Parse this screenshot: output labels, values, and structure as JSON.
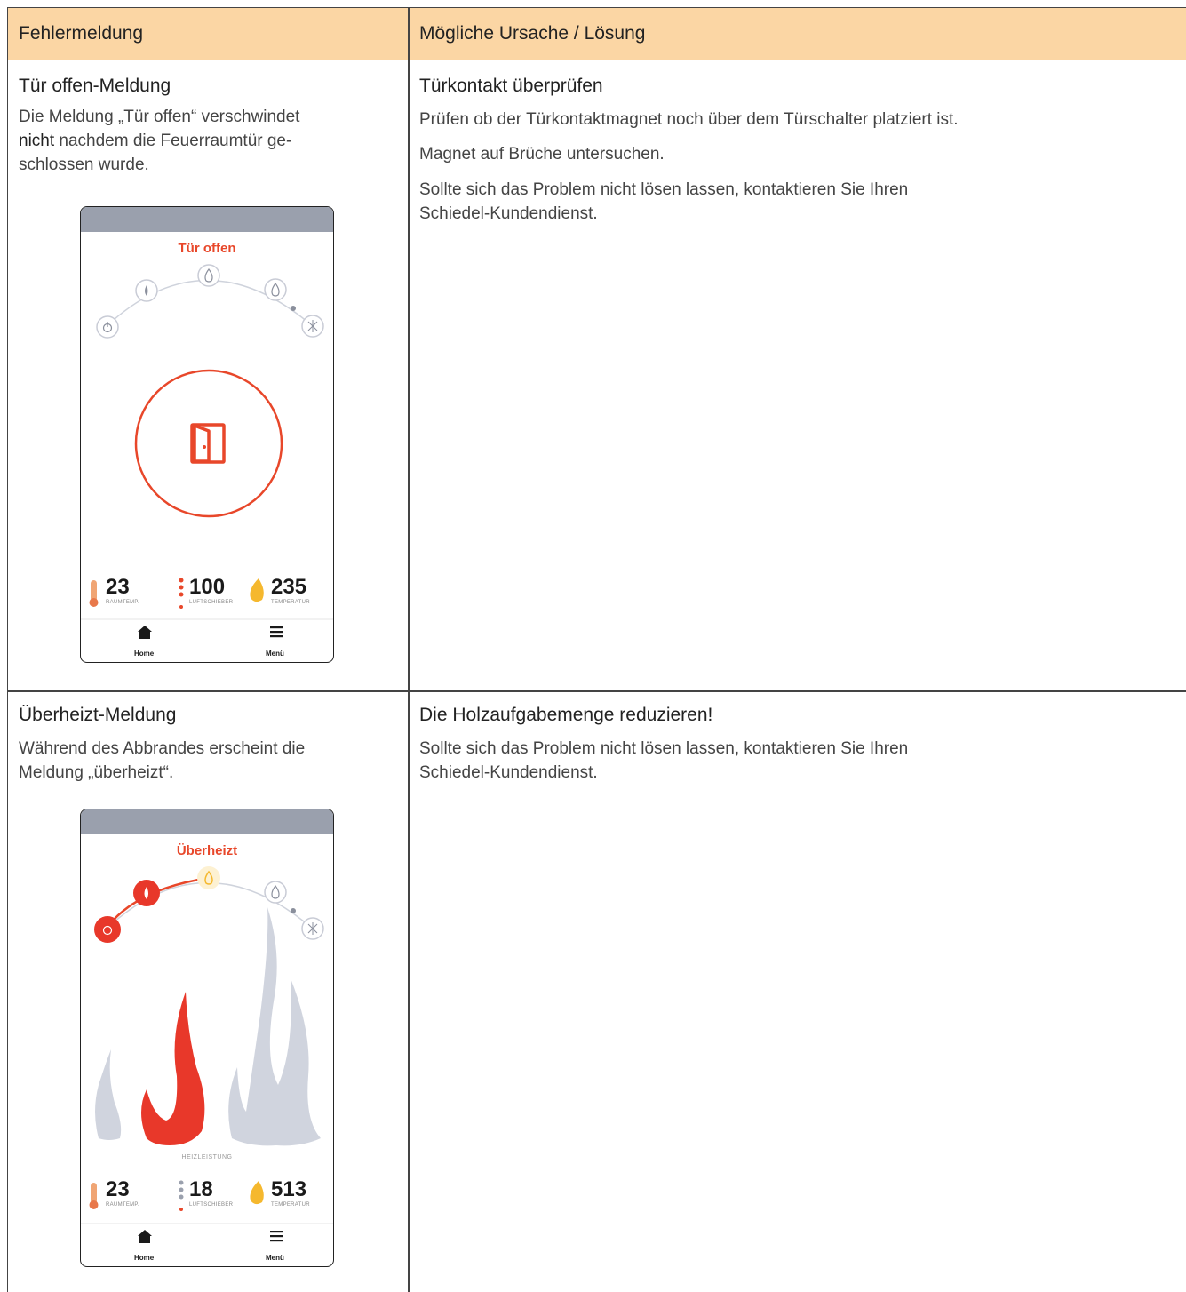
{
  "header": {
    "col1": "Fehlermeldung",
    "col2": "Mögliche Ursache / Lösung"
  },
  "rows": [
    {
      "title": "Tür offen-Meldung",
      "desc_pre": "Die Meldung „Tür offen“ verschwindet",
      "desc_bold": "nicht",
      "desc_post1": " nachdem die Feuerraumtür ge-",
      "desc_post2": "schlossen wurde.",
      "solution_title": "Türkontakt überprüfen",
      "solution_lines": [
        "Prüfen ob der Türkontaktmagnet noch über dem Türschalter platziert ist.",
        "Magnet auf Brüche untersuchen.",
        "Sollte sich das Problem nicht lösen lassen, kontaktieren Sie Ihren",
        "Schiedel-Kundendienst."
      ],
      "phone": {
        "status": "Tür offen",
        "stats": [
          {
            "value": "23",
            "label": "RAUMTEMP."
          },
          {
            "value": "100",
            "label": "LUFTSCHIEBER"
          },
          {
            "value": "235",
            "label": "TEMPERATUR"
          }
        ],
        "nav": [
          "Home",
          "Menü"
        ]
      }
    },
    {
      "title": "Überheizt-Meldung",
      "desc_line1": "Während des Abbrandes erscheint die",
      "desc_line2": "Meldung „überheizt“.",
      "solution_title": "Die Holzaufgabemenge reduzieren!",
      "solution_lines": [
        "Sollte sich das Problem nicht lösen lassen, kontaktieren Sie Ihren",
        "Schiedel-Kundendienst."
      ],
      "phone": {
        "status": "Überheizt",
        "power_label": "HEIZLEISTUNG",
        "stats": [
          {
            "value": "23",
            "label": "RAUMTEMP."
          },
          {
            "value": "18",
            "label": "LUFTSCHIEBER"
          },
          {
            "value": "513",
            "label": "TEMPERATUR"
          }
        ],
        "nav": [
          "Home",
          "Menü"
        ]
      }
    }
  ],
  "colors": {
    "header_bg": "#fbd6a4",
    "alert_red": "#e8472a",
    "flame_yellow": "#f5b82e",
    "muted_flame": "#d0d4de"
  }
}
